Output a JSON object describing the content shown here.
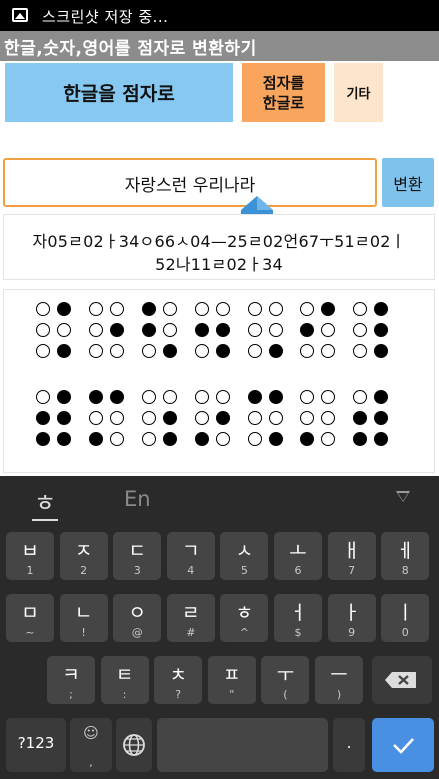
{
  "status_bar": {
    "notification": "스크린샷 저장 중..."
  },
  "app_title": "한글,숫자,영어를 점자로 변환하기",
  "mode_buttons": {
    "hangul_to_braille": "한글을 점자로",
    "braille_to_hangul_1": "점자를",
    "braille_to_hangul_2": "한글로",
    "other": "기타"
  },
  "input": {
    "value": "자랑스런 우리나라"
  },
  "convert_button": "변환",
  "code_output": {
    "line1": "자05ㄹ02ㅏ34ㅇ66ㅅ04—25ㄹ02언67ㅜ51ㄹ02ㅣ",
    "line2": "52나11ㄹ02ㅏ34"
  },
  "braille_cells_row1": [
    [
      0,
      1,
      0,
      0,
      0,
      1
    ],
    [
      0,
      0,
      0,
      1,
      0,
      0
    ],
    [
      1,
      0,
      1,
      0,
      0,
      1
    ],
    [
      0,
      0,
      1,
      1,
      0,
      1
    ],
    [
      0,
      0,
      0,
      0,
      0,
      1
    ],
    [
      0,
      1,
      1,
      0,
      0,
      0
    ],
    [
      0,
      1,
      0,
      1,
      0,
      1
    ]
  ],
  "braille_cells_row2": [
    [
      0,
      1,
      1,
      1,
      1,
      1
    ],
    [
      1,
      1,
      0,
      0,
      1,
      0
    ],
    [
      0,
      0,
      0,
      1,
      0,
      1
    ],
    [
      0,
      0,
      0,
      1,
      1,
      0
    ],
    [
      1,
      1,
      0,
      0,
      0,
      1
    ],
    [
      0,
      0,
      0,
      0,
      1,
      0
    ],
    [
      0,
      1,
      1,
      1,
      1,
      1
    ]
  ],
  "keyboard": {
    "lang_en": "En",
    "hangul_icon": "ㅎ",
    "row1": [
      {
        "main": "ㅂ",
        "sub": "1"
      },
      {
        "main": "ㅈ",
        "sub": "2"
      },
      {
        "main": "ㄷ",
        "sub": "3"
      },
      {
        "main": "ㄱ",
        "sub": "4"
      },
      {
        "main": "ㅅ",
        "sub": "5"
      },
      {
        "main": "ㅗ",
        "sub": "6"
      },
      {
        "main": "ㅐ",
        "sub": "7"
      },
      {
        "main": "ㅔ",
        "sub": "8"
      }
    ],
    "row2": [
      {
        "main": "ㅁ",
        "sub": "~"
      },
      {
        "main": "ㄴ",
        "sub": "!"
      },
      {
        "main": "ㅇ",
        "sub": "@"
      },
      {
        "main": "ㄹ",
        "sub": "#"
      },
      {
        "main": "ㅎ",
        "sub": "^"
      },
      {
        "main": "ㅓ",
        "sub": "$"
      },
      {
        "main": "ㅏ",
        "sub": "9"
      },
      {
        "main": "ㅣ",
        "sub": "0"
      }
    ],
    "row3": [
      {
        "main": "ㅋ",
        "sub": ";"
      },
      {
        "main": "ㅌ",
        "sub": ":"
      },
      {
        "main": "ㅊ",
        "sub": "?"
      },
      {
        "main": "ㅍ",
        "sub": "\""
      },
      {
        "main": "ㅜ",
        "sub": "("
      },
      {
        "main": "ㅡ",
        "sub": ")"
      }
    ],
    "symbols_key": "?123",
    "emoji_sub": ",",
    "period_key": "."
  }
}
